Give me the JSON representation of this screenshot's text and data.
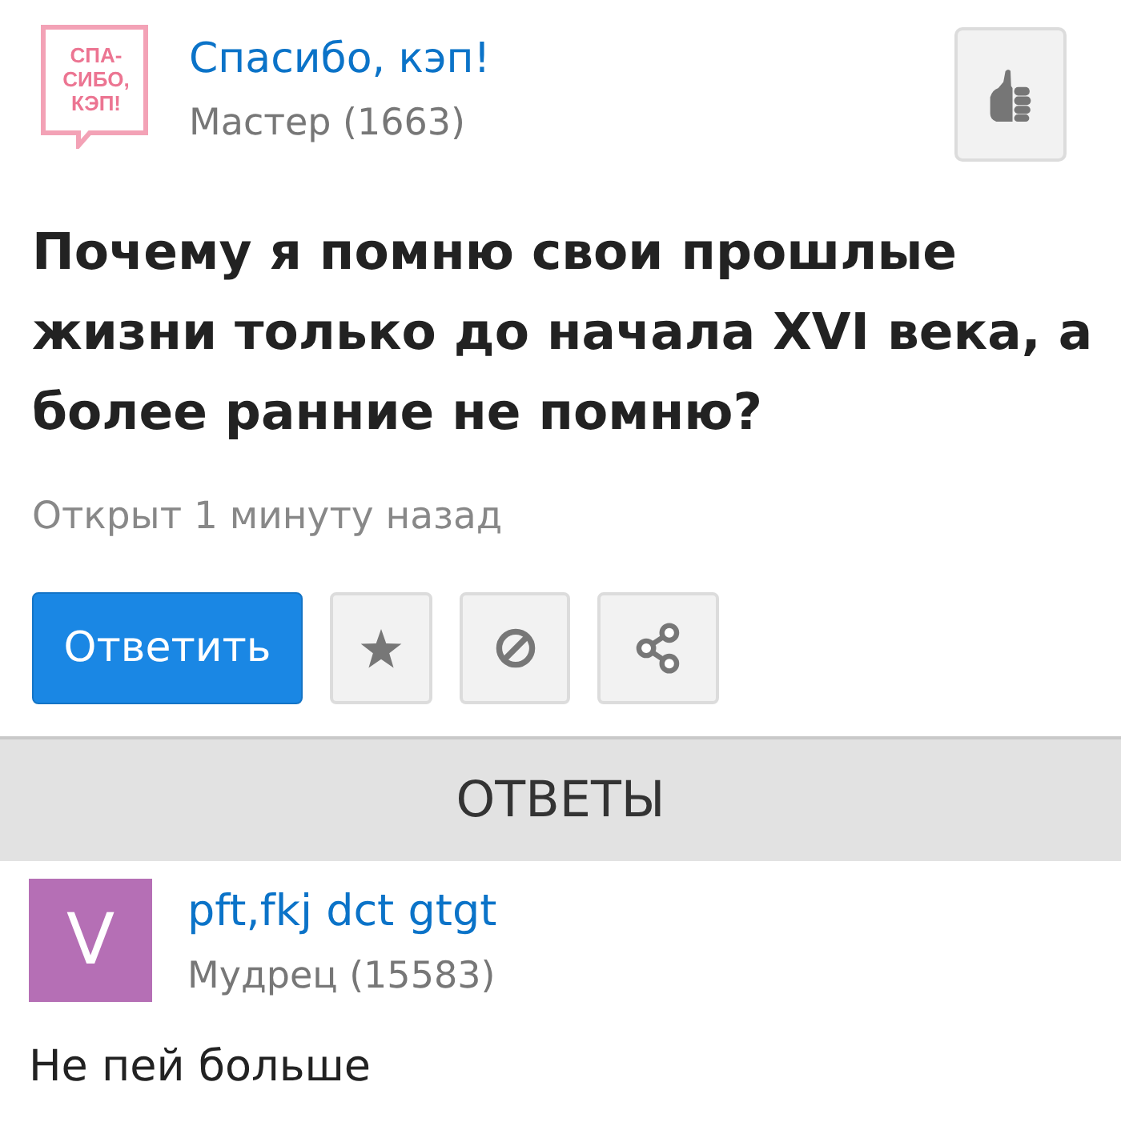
{
  "question_author": {
    "logo_lines": [
      "СПА-",
      "СИБО,",
      "КЭП!"
    ],
    "name": "Спасибо, кэп!",
    "rank": "Мастер (1663)"
  },
  "question": {
    "title": "Почему я помню свои прошлые жизни только до начала XVI века, а более ранние не помню?",
    "meta": "Открыт 1 минуту назад"
  },
  "actions": [
    {
      "kind": "reply",
      "label": "Ответить"
    },
    {
      "kind": "favorite"
    },
    {
      "kind": "block"
    },
    {
      "kind": "share"
    }
  ],
  "answers_header": "ОТВЕТЫ",
  "answers": [
    {
      "avatar_letter": "V",
      "color": "#b56fb5",
      "name": "pft,fkj dct gtgt",
      "rank": "Мудрец (15583)",
      "text": "Не пей больше"
    }
  ]
}
